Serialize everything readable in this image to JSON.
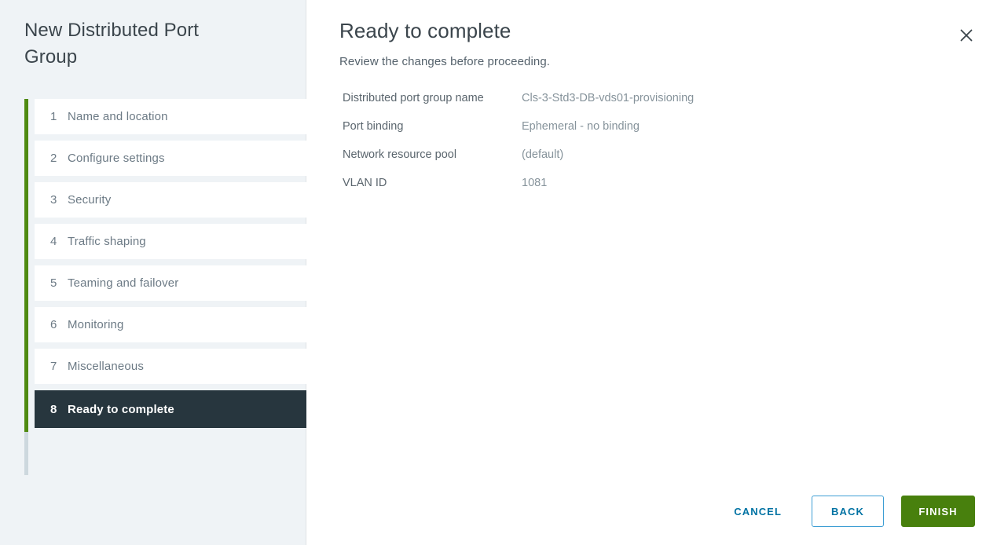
{
  "wizard": {
    "title": "New Distributed Port Group",
    "steps": [
      {
        "num": "1",
        "label": "Name and location",
        "active": false
      },
      {
        "num": "2",
        "label": "Configure settings",
        "active": false
      },
      {
        "num": "3",
        "label": "Security",
        "active": false
      },
      {
        "num": "4",
        "label": "Traffic shaping",
        "active": false
      },
      {
        "num": "5",
        "label": "Teaming and failover",
        "active": false
      },
      {
        "num": "6",
        "label": "Monitoring",
        "active": false
      },
      {
        "num": "7",
        "label": "Miscellaneous",
        "active": false
      },
      {
        "num": "8",
        "label": "Ready to complete",
        "active": true
      }
    ],
    "rail_color": "#4f8a10",
    "rail_inactive_color": "#cdd8de"
  },
  "main": {
    "title": "Ready to complete",
    "subtitle": "Review the changes before proceeding.",
    "close_icon": "close-icon",
    "summary": [
      {
        "label": "Distributed port group name",
        "value": "Cls-3-Std3-DB-vds01-provisioning"
      },
      {
        "label": "Port binding",
        "value": "Ephemeral - no binding"
      },
      {
        "label": "Network resource pool",
        "value": "(default)"
      },
      {
        "label": "VLAN ID",
        "value": "1081"
      }
    ]
  },
  "footer": {
    "cancel_label": "CANCEL",
    "back_label": "BACK",
    "finish_label": "FINISH"
  },
  "colors": {
    "accent_green": "#48800d",
    "accent_blue": "#0072a3",
    "active_step_bg": "#27363e",
    "sidebar_bg": "#eff3f6"
  }
}
